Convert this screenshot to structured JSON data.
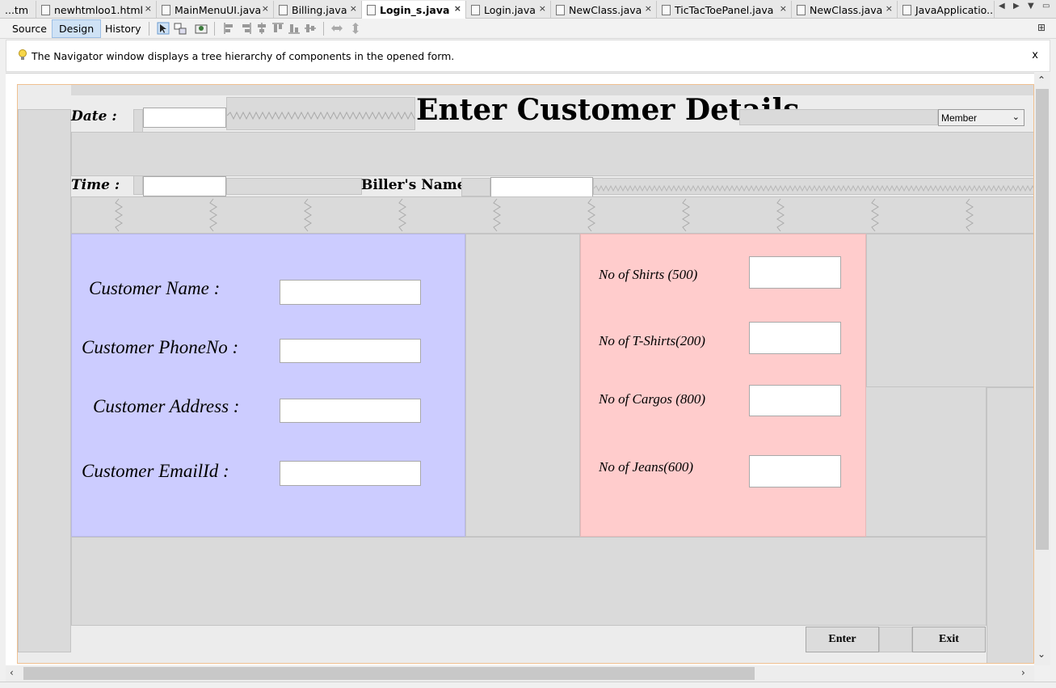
{
  "tabs": [
    {
      "label": "...tm"
    },
    {
      "label": "newhtmloo1.html"
    },
    {
      "label": "MainMenuUI.java"
    },
    {
      "label": "Billing.java"
    },
    {
      "label": "Login_s.java"
    },
    {
      "label": "Login.java"
    },
    {
      "label": "NewClass.java"
    },
    {
      "label": "TicTacToePanel.java"
    },
    {
      "label": "NewClass.java"
    },
    {
      "label": "JavaApplicatio..."
    }
  ],
  "close_glyph": "×",
  "toolbar": {
    "source_label": "Source",
    "design_label": "Design",
    "history_label": "History"
  },
  "info": {
    "text": "The Navigator window displays a tree hierarchy of components in the opened form.",
    "close": "x"
  },
  "form": {
    "title": "Enter Customer Details",
    "date_label": "Date :",
    "time_label": "Time :",
    "biller_label": "Biller's Name :",
    "member_select": "Member",
    "customer_name_label": "Customer Name :",
    "customer_phone_label": "Customer PhoneNo :",
    "customer_address_label": "Customer Address :",
    "customer_email_label": "Customer EmailId :",
    "shirts_label": "No of  Shirts (500)",
    "tshirts_label": "No of T-Shirts(200)",
    "cargos_label": "No of Cargos (800)",
    "jeans_label": "No of Jeans(600)",
    "enter_label": "Enter",
    "exit_label": "Exit"
  },
  "colors": {
    "customer_panel": "#ccccff",
    "order_panel": "#ffcccc",
    "design_selected": "#cfe2f5"
  }
}
